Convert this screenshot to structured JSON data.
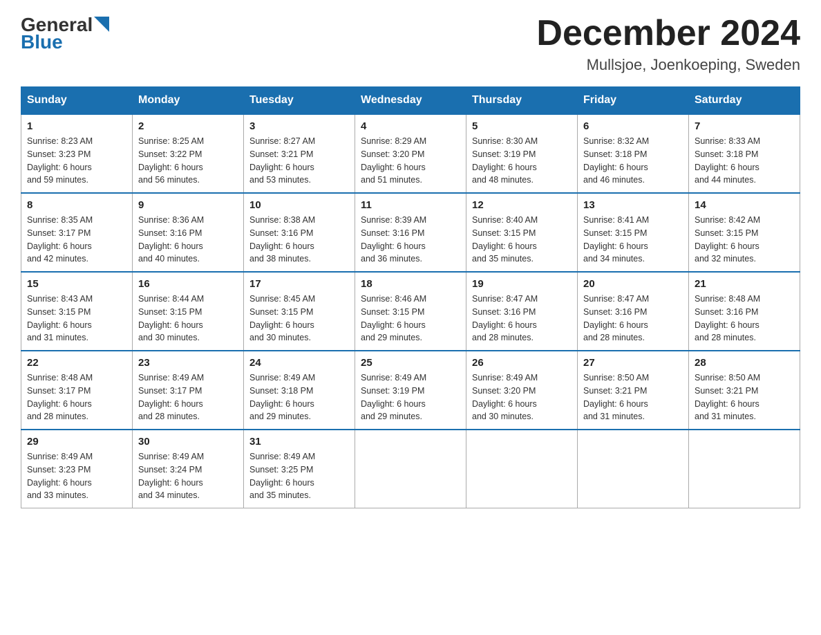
{
  "header": {
    "title": "December 2024",
    "subtitle": "Mullsjoe, Joenkoeping, Sweden",
    "logo_general": "General",
    "logo_blue": "Blue"
  },
  "days_of_week": [
    "Sunday",
    "Monday",
    "Tuesday",
    "Wednesday",
    "Thursday",
    "Friday",
    "Saturday"
  ],
  "weeks": [
    [
      {
        "day": "1",
        "sunrise": "8:23 AM",
        "sunset": "3:23 PM",
        "daylight": "6 hours and 59 minutes."
      },
      {
        "day": "2",
        "sunrise": "8:25 AM",
        "sunset": "3:22 PM",
        "daylight": "6 hours and 56 minutes."
      },
      {
        "day": "3",
        "sunrise": "8:27 AM",
        "sunset": "3:21 PM",
        "daylight": "6 hours and 53 minutes."
      },
      {
        "day": "4",
        "sunrise": "8:29 AM",
        "sunset": "3:20 PM",
        "daylight": "6 hours and 51 minutes."
      },
      {
        "day": "5",
        "sunrise": "8:30 AM",
        "sunset": "3:19 PM",
        "daylight": "6 hours and 48 minutes."
      },
      {
        "day": "6",
        "sunrise": "8:32 AM",
        "sunset": "3:18 PM",
        "daylight": "6 hours and 46 minutes."
      },
      {
        "day": "7",
        "sunrise": "8:33 AM",
        "sunset": "3:18 PM",
        "daylight": "6 hours and 44 minutes."
      }
    ],
    [
      {
        "day": "8",
        "sunrise": "8:35 AM",
        "sunset": "3:17 PM",
        "daylight": "6 hours and 42 minutes."
      },
      {
        "day": "9",
        "sunrise": "8:36 AM",
        "sunset": "3:16 PM",
        "daylight": "6 hours and 40 minutes."
      },
      {
        "day": "10",
        "sunrise": "8:38 AM",
        "sunset": "3:16 PM",
        "daylight": "6 hours and 38 minutes."
      },
      {
        "day": "11",
        "sunrise": "8:39 AM",
        "sunset": "3:16 PM",
        "daylight": "6 hours and 36 minutes."
      },
      {
        "day": "12",
        "sunrise": "8:40 AM",
        "sunset": "3:15 PM",
        "daylight": "6 hours and 35 minutes."
      },
      {
        "day": "13",
        "sunrise": "8:41 AM",
        "sunset": "3:15 PM",
        "daylight": "6 hours and 34 minutes."
      },
      {
        "day": "14",
        "sunrise": "8:42 AM",
        "sunset": "3:15 PM",
        "daylight": "6 hours and 32 minutes."
      }
    ],
    [
      {
        "day": "15",
        "sunrise": "8:43 AM",
        "sunset": "3:15 PM",
        "daylight": "6 hours and 31 minutes."
      },
      {
        "day": "16",
        "sunrise": "8:44 AM",
        "sunset": "3:15 PM",
        "daylight": "6 hours and 30 minutes."
      },
      {
        "day": "17",
        "sunrise": "8:45 AM",
        "sunset": "3:15 PM",
        "daylight": "6 hours and 30 minutes."
      },
      {
        "day": "18",
        "sunrise": "8:46 AM",
        "sunset": "3:15 PM",
        "daylight": "6 hours and 29 minutes."
      },
      {
        "day": "19",
        "sunrise": "8:47 AM",
        "sunset": "3:16 PM",
        "daylight": "6 hours and 28 minutes."
      },
      {
        "day": "20",
        "sunrise": "8:47 AM",
        "sunset": "3:16 PM",
        "daylight": "6 hours and 28 minutes."
      },
      {
        "day": "21",
        "sunrise": "8:48 AM",
        "sunset": "3:16 PM",
        "daylight": "6 hours and 28 minutes."
      }
    ],
    [
      {
        "day": "22",
        "sunrise": "8:48 AM",
        "sunset": "3:17 PM",
        "daylight": "6 hours and 28 minutes."
      },
      {
        "day": "23",
        "sunrise": "8:49 AM",
        "sunset": "3:17 PM",
        "daylight": "6 hours and 28 minutes."
      },
      {
        "day": "24",
        "sunrise": "8:49 AM",
        "sunset": "3:18 PM",
        "daylight": "6 hours and 29 minutes."
      },
      {
        "day": "25",
        "sunrise": "8:49 AM",
        "sunset": "3:19 PM",
        "daylight": "6 hours and 29 minutes."
      },
      {
        "day": "26",
        "sunrise": "8:49 AM",
        "sunset": "3:20 PM",
        "daylight": "6 hours and 30 minutes."
      },
      {
        "day": "27",
        "sunrise": "8:50 AM",
        "sunset": "3:21 PM",
        "daylight": "6 hours and 31 minutes."
      },
      {
        "day": "28",
        "sunrise": "8:50 AM",
        "sunset": "3:21 PM",
        "daylight": "6 hours and 31 minutes."
      }
    ],
    [
      {
        "day": "29",
        "sunrise": "8:49 AM",
        "sunset": "3:23 PM",
        "daylight": "6 hours and 33 minutes."
      },
      {
        "day": "30",
        "sunrise": "8:49 AM",
        "sunset": "3:24 PM",
        "daylight": "6 hours and 34 minutes."
      },
      {
        "day": "31",
        "sunrise": "8:49 AM",
        "sunset": "3:25 PM",
        "daylight": "6 hours and 35 minutes."
      },
      null,
      null,
      null,
      null
    ]
  ],
  "cell_labels": {
    "sunrise_prefix": "Sunrise: ",
    "sunset_prefix": "Sunset: ",
    "daylight_prefix": "Daylight: "
  }
}
